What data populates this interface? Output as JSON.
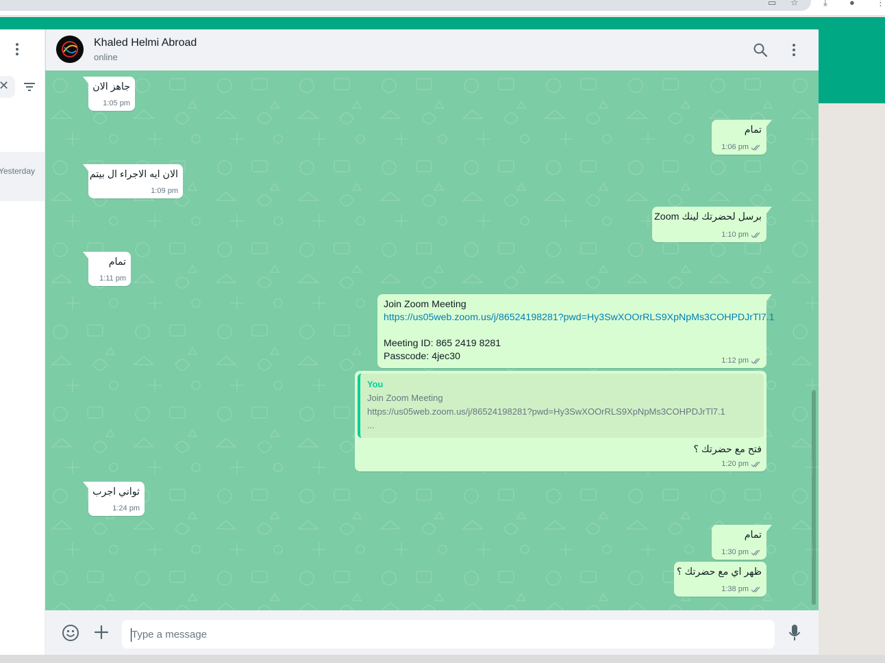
{
  "browser": {
    "icons": [
      "monitor-icon",
      "star-icon",
      "download-icon",
      "profile-icon",
      "menu-icon"
    ]
  },
  "sidebar": {
    "date_label": "Yesterday"
  },
  "header": {
    "contact_name": "Khaled Helmi Abroad",
    "status": "online"
  },
  "messages": [
    {
      "dir": "in",
      "text": "جاهز الان",
      "time": "1:05 pm"
    },
    {
      "dir": "out",
      "text": "تمام",
      "time": "1:06 pm"
    },
    {
      "dir": "in",
      "text": "الان ايه الاجراء ال بيتم",
      "time": "1:09 pm"
    },
    {
      "dir": "out",
      "text": "برسل لحضرتك لينك Zoom",
      "time": "1:10 pm"
    },
    {
      "dir": "in",
      "text": "تمام",
      "time": "1:11 pm"
    },
    {
      "dir": "out",
      "lines": [
        "Join Zoom Meeting",
        "https://us05web.zoom.us/j/86524198281?pwd=Hy3SwXOOrRLS9XpNpMs3COHPDJrTl7.1",
        "",
        "Meeting ID: 865 2419 8281",
        "Passcode: 4jec30"
      ],
      "time": "1:12 pm"
    },
    {
      "dir": "out",
      "quote": {
        "author": "You",
        "lines": [
          "Join Zoom Meeting",
          "https://us05web.zoom.us/j/86524198281?pwd=Hy3SwXOOrRLS9XpNpMs3COHPDJrTl7.1",
          "..."
        ]
      },
      "text": "فتح مع حضرتك ؟",
      "time": "1:20 pm"
    },
    {
      "dir": "in",
      "text": "ثواني اجرب",
      "time": "1:24 pm"
    },
    {
      "dir": "out",
      "text": "تمام",
      "time": "1:30 pm"
    },
    {
      "dir": "out",
      "text": "ظهر اي مع حضرتك ؟",
      "time": "1:38 pm"
    }
  ],
  "composer": {
    "placeholder": "Type a message"
  },
  "colors": {
    "brand_green": "#00a884",
    "chat_background": "#7ccca5",
    "outgoing_bubble": "#d9fdd3",
    "incoming_bubble": "#ffffff",
    "link": "#027eb5",
    "quote_accent": "#06cf9c"
  }
}
